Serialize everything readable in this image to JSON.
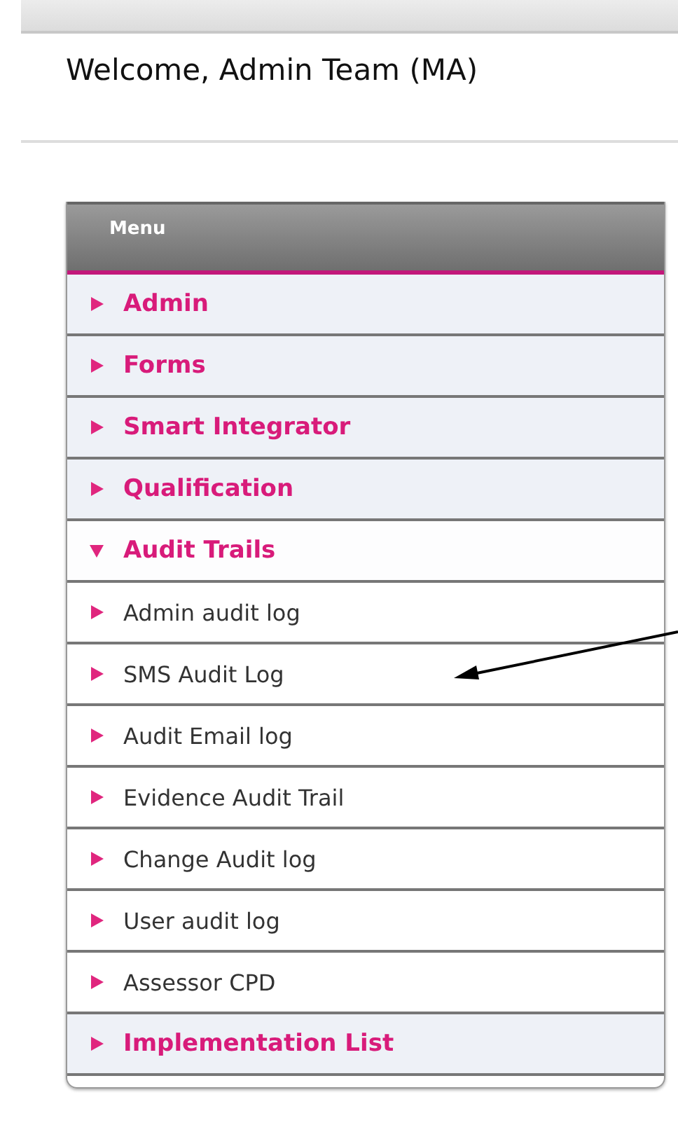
{
  "welcome": "Welcome, Admin Team (MA)",
  "menu": {
    "title": "Menu",
    "items": [
      {
        "kind": "section",
        "label": "Admin",
        "expanded": false
      },
      {
        "kind": "section",
        "label": "Forms",
        "expanded": false
      },
      {
        "kind": "section",
        "label": "Smart Integrator",
        "expanded": false
      },
      {
        "kind": "section",
        "label": "Qualification",
        "expanded": false
      },
      {
        "kind": "section",
        "label": "Audit Trails",
        "expanded": true,
        "children": [
          {
            "label": "Admin audit log"
          },
          {
            "label": "SMS Audit Log"
          },
          {
            "label": "Audit Email log"
          },
          {
            "label": "Evidence Audit Trail"
          },
          {
            "label": "Change Audit log"
          },
          {
            "label": "User audit log"
          },
          {
            "label": "Assessor CPD"
          }
        ]
      },
      {
        "kind": "section",
        "label": "Implementation List",
        "expanded": false
      }
    ]
  }
}
